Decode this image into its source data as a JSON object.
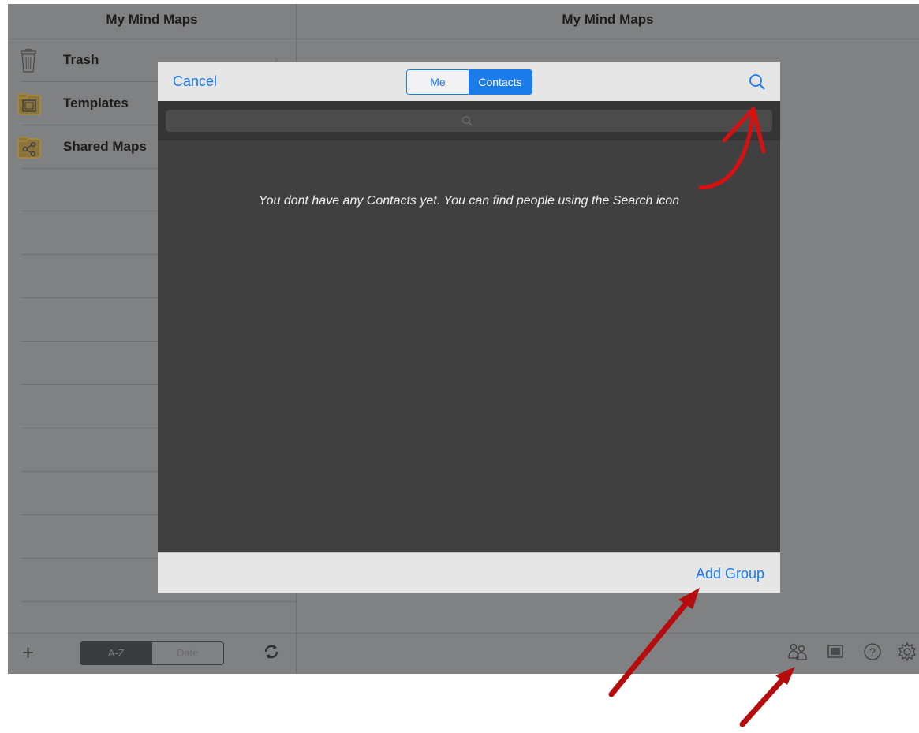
{
  "left_pane": {
    "title": "My Mind Maps",
    "folders": [
      {
        "label": "Trash",
        "icon": "trash-icon"
      },
      {
        "label": "Templates",
        "icon": "templates-folder-icon"
      },
      {
        "label": "Shared Maps",
        "icon": "shared-folder-icon"
      }
    ]
  },
  "right_pane": {
    "title": "My Mind Maps"
  },
  "bottom_bar": {
    "add_icon": "plus-icon",
    "sort": {
      "options": [
        "A-Z",
        "Date"
      ],
      "selected": "A-Z"
    },
    "sync_icon": "sync-icon",
    "tool_icons": [
      "contacts-icon",
      "presentation-icon",
      "help-icon",
      "settings-icon"
    ]
  },
  "modal": {
    "cancel_label": "Cancel",
    "tabs": [
      {
        "label": "Me",
        "selected": false
      },
      {
        "label": "Contacts",
        "selected": true
      }
    ],
    "search_icon": "search-icon",
    "empty_message": "You dont have any Contacts yet. You can find people using the Search icon",
    "add_group_label": "Add Group"
  },
  "colors": {
    "accent": "#1a7bea",
    "annotation": "#cc0000",
    "dim": "#808182",
    "modal_body": "#404041"
  }
}
